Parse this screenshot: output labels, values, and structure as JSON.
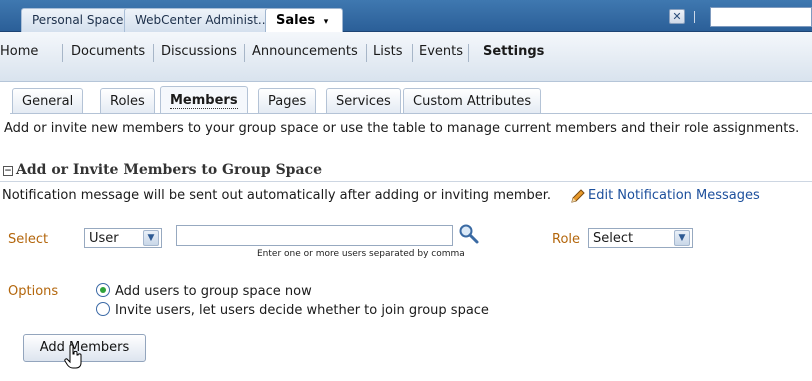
{
  "space_tabs": [
    {
      "label": "Personal Space"
    },
    {
      "label": "WebCenter Administ..."
    },
    {
      "label": "Sales",
      "active": true,
      "caret": "▾"
    }
  ],
  "toolbar": {
    "close_icon": "close-icon",
    "search_value": ""
  },
  "nav": {
    "items": [
      {
        "label": "Home"
      },
      {
        "label": "Documents"
      },
      {
        "label": "Discussions"
      },
      {
        "label": "Announcements"
      },
      {
        "label": "Lists"
      },
      {
        "label": "Events"
      },
      {
        "label": "Settings",
        "active": true
      }
    ]
  },
  "subtabs": [
    {
      "label": "General"
    },
    {
      "label": "Roles"
    },
    {
      "label": "Members",
      "active": true
    },
    {
      "label": "Pages"
    },
    {
      "label": "Services"
    },
    {
      "label": "Custom Attributes"
    }
  ],
  "intro_text": "Add or invite new members to your group space or use the table to manage current members and their role assignments.",
  "section": {
    "collapse_glyph": "−",
    "title": "Add or Invite Members to Group Space",
    "notification_text": "Notification message will be sent out automatically after adding or inviting member.",
    "edit_link": "Edit Notification Messages"
  },
  "form": {
    "select_label": "Select",
    "select_value": "User",
    "users_value": "",
    "users_hint": "Enter one or more users separated by comma",
    "role_label": "Role",
    "role_value": "Select",
    "options_label": "Options",
    "options": [
      {
        "label": "Add users to group space now",
        "selected": true
      },
      {
        "label": "Invite users, let users decide whether to join group space",
        "selected": false
      }
    ],
    "add_button": "Add Members"
  },
  "colors": {
    "accent": "#2b5f98",
    "link": "#1c4f9c",
    "label": "#b3660c",
    "radio_on": "#2fa33a"
  }
}
